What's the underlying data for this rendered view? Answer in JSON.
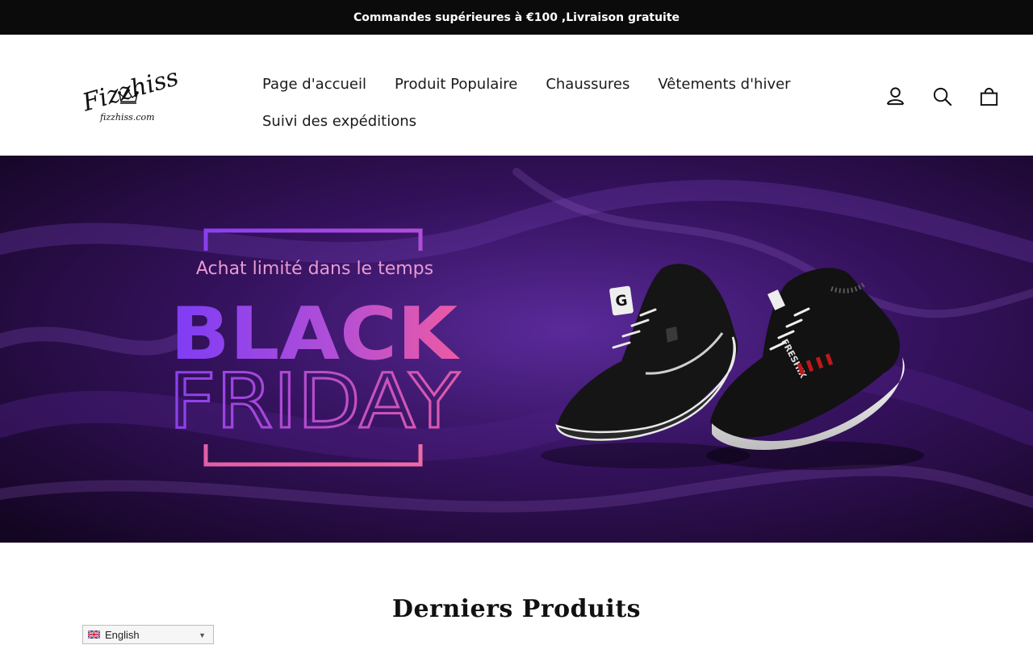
{
  "announcement": {
    "text": "Commandes supérieures à €100 ,Livraison gratuite"
  },
  "logo": {
    "name": "Fizzhiss",
    "domain": "fizzhiss.com"
  },
  "nav": {
    "row1": [
      "Page d'accueil",
      "Produit Populaire",
      "Chaussures",
      "Vêtements d'hiver"
    ],
    "row2": [
      "Suivi des expéditions"
    ]
  },
  "header_icons": [
    "user-icon",
    "search-icon",
    "cart-icon"
  ],
  "hero": {
    "tagline": "Achat limité dans le temps",
    "headline_1": "BLACK",
    "headline_2": "FRIDAY",
    "shoe_logo_letter": "G",
    "shoe_brand_text": "FRESHIX"
  },
  "section": {
    "title": "Derniers Produits"
  },
  "language_selector": {
    "value": "English",
    "flag": "uk-flag-icon"
  },
  "colors": {
    "announcement_bg": "#0b0b0b",
    "hero_bg": "#2a0d4a",
    "accent_pink": "#e0549e",
    "accent_purple": "#7d3cf5"
  }
}
